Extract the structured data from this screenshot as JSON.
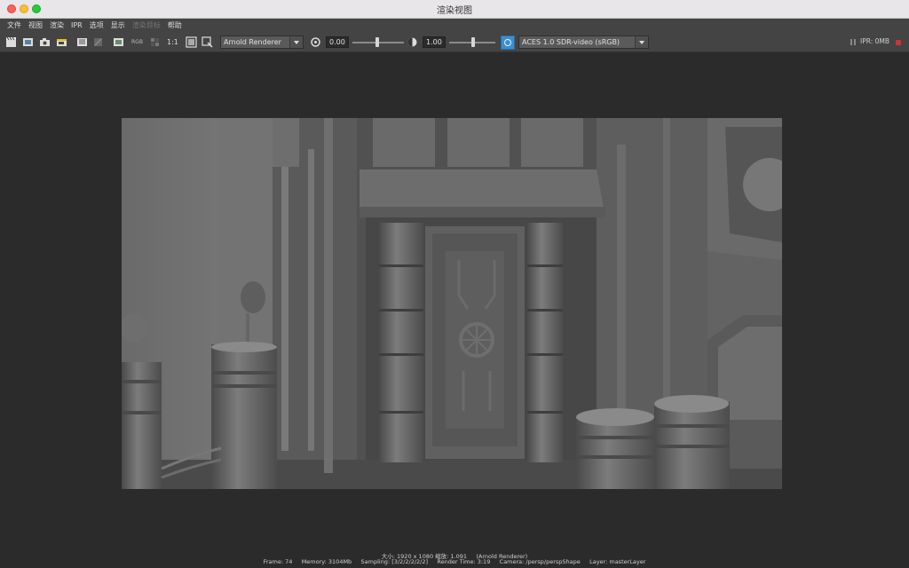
{
  "window": {
    "title": "渲染视图"
  },
  "menu": {
    "items": [
      "文件",
      "视图",
      "渲染",
      "IPR",
      "选项",
      "显示",
      "渲染目标",
      "帮助"
    ],
    "disabled_index": 6
  },
  "toolbar": {
    "zoom_label": "1:1",
    "rgb_label": "RGB",
    "renderer": "Arnold Renderer",
    "exposure": "0.00",
    "gamma": "1.00",
    "view_transform": "ACES 1.0 SDR-video (sRGB)",
    "ipr_memory": "IPR: 0MB"
  },
  "status": {
    "line1": "大小: 1920 x 1080 缩放: 1.091     (Arnold Renderer)",
    "line2": "Frame: 74     Memory: 3104Mb     Sampling: [3/2/2/2/2/2]     Render Time: 3:19     Camera: /persp/perspShape     Layer: masterLayer"
  },
  "icons": {
    "render": "clapperboard-icon",
    "ipr": "ipr-render-icon",
    "snapshot": "camera-snapshot-icon",
    "region": "render-region-icon",
    "refresh": "refresh-icon",
    "keep": "keep-image-icon",
    "remove": "remove-image-icon",
    "display_channel": "display-channel-icon",
    "fit": "fit-image-icon",
    "frame": "frame-image-icon",
    "exposure": "exposure-icon",
    "gamma": "gamma-icon",
    "ocio": "color-management-icon",
    "ipr_pause": "pause-icon",
    "ipr_stop": "stop-icon"
  }
}
